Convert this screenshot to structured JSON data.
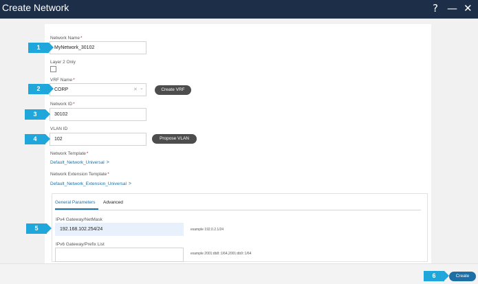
{
  "window": {
    "title": "Create Network",
    "help_icon": "?",
    "minimize_icon": "—",
    "close_icon": "✕"
  },
  "form": {
    "network_name": {
      "label": "Network Name",
      "required": "*",
      "value": "MyNetwork_30102"
    },
    "layer2": {
      "label": "Layer 2 Only",
      "checked": false
    },
    "vrf_name": {
      "label": "VRF Name",
      "required": "*",
      "value": "CORP",
      "clear_icon": "✕",
      "dropdown_icon": "⌄"
    },
    "create_vrf_label": "Create VRF",
    "network_id": {
      "label": "Network ID",
      "required": "*",
      "value": "30102"
    },
    "vlan_id": {
      "label": "VLAN ID",
      "value": "102"
    },
    "propose_vlan_label": "Propose VLAN",
    "network_template": {
      "label": "Network Template",
      "required": "*",
      "value": "Default_Network_Universal"
    },
    "extension_template": {
      "label": "Network Extension Template",
      "required": "*",
      "value": "Default_Network_Extension_Universal"
    }
  },
  "tabs": {
    "items": [
      "General Parameters",
      "Advanced"
    ],
    "active": "General Parameters"
  },
  "general": {
    "ipv4": {
      "label": "IPv4 Gateway/NetMask",
      "value": "192.168.102.254/24",
      "example": "example 192.0.2.1/24"
    },
    "ipv6": {
      "label": "IPv6 Gateway/Prefix List",
      "value": "",
      "example": "example 2001:db8::1/64,2001:db9::1/64"
    }
  },
  "steps": [
    "1",
    "2",
    "3",
    "4",
    "5",
    "6"
  ],
  "footer": {
    "create_label": "Create"
  },
  "colors": {
    "header": "#1d2f48",
    "step_badge": "#1fa6da",
    "link": "#1d6fa5",
    "pill": "#4d4d4d"
  }
}
